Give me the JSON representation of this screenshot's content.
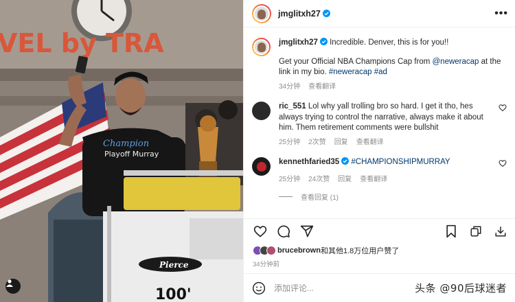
{
  "post": {
    "username": "jmglitxh27",
    "caption_text_1": "Incredible. Denver, this is for you!!",
    "caption_text_2_prefix": "Get your Official NBA Champions Cap from ",
    "caption_mention": "@neweracap",
    "caption_text_2_suffix": " at the link in my bio. ",
    "caption_hashtags": "#neweracap #ad",
    "caption_time": "34分钟",
    "caption_translate": "查看翻译"
  },
  "comments": [
    {
      "username": "ric_551",
      "text": "Lol why yall trolling bro so hard. I get it tho, hes always trying to control the narrative, always make it about him. Them retirement comments were bullshit",
      "time": "25分钟",
      "likes": "2次赞",
      "reply": "回复",
      "translate": "查看翻译"
    },
    {
      "username": "kennethfaried35",
      "text": "#CHAMPIONSHIPMURRAY",
      "time": "25分钟",
      "likes": "24次赞",
      "reply": "回复",
      "translate": "查看翻译",
      "view_replies": "查看回复 (1)"
    }
  ],
  "likes": {
    "liker": "brucebrown",
    "suffix": "和其他1.8万位用户赞了"
  },
  "timestamp": "34分钟前",
  "composer": {
    "placeholder": "添加评论..."
  },
  "watermark": "头条 @90后球迷者",
  "photo": {
    "sign_text": "VEL by TRA",
    "bus_brand": "Pierce",
    "bus_number": "100'",
    "shirt_text_1": "Champion",
    "shirt_text_2": "Playoff Murray"
  },
  "colors": {
    "verified": "#0095f6",
    "link": "#00376b",
    "meta": "#8e8e8e"
  }
}
